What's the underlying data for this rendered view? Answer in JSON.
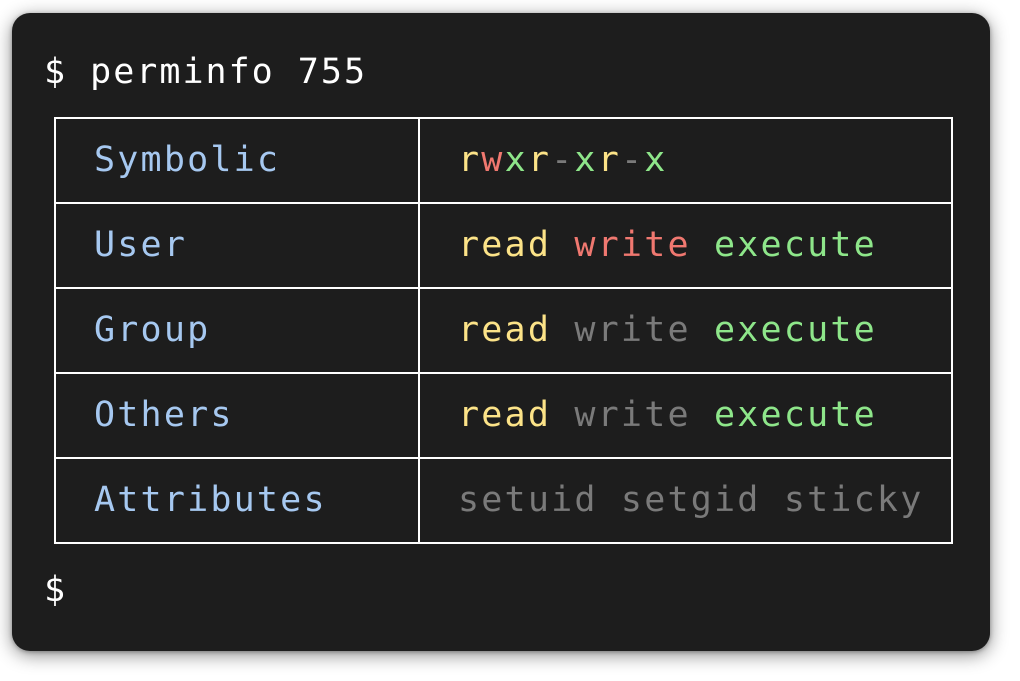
{
  "terminal": {
    "prompt": "$",
    "command": "perminfo 755"
  },
  "rows": [
    {
      "label": "Symbolic",
      "symbolic": [
        "r",
        "w",
        "x",
        "r",
        "-",
        "x",
        "r",
        "-",
        "x"
      ]
    },
    {
      "label": "User",
      "words": [
        "read",
        "write",
        "execute"
      ]
    },
    {
      "label": "Group",
      "words": [
        "read",
        "write",
        "execute"
      ]
    },
    {
      "label": "Others",
      "words": [
        "read",
        "write",
        "execute"
      ]
    },
    {
      "label": "Attributes",
      "words": [
        "setuid",
        "setgid",
        "sticky"
      ]
    }
  ],
  "colors": {
    "background": "#1d1d1d",
    "label": "#a6c8f0",
    "read": "#fce388",
    "write": "#f07870",
    "execute": "#8ee68a",
    "disabled": "#7a7a7a"
  }
}
